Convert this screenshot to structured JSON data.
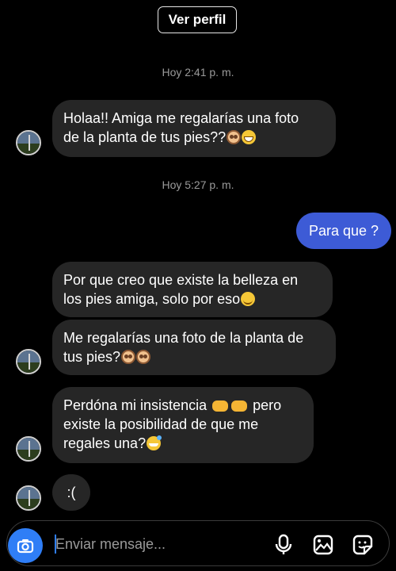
{
  "header": {
    "view_profile_label": "Ver perfil"
  },
  "timestamps": {
    "first": "Hoy 2:41 p. m.",
    "second": "Hoy 5:27 p. m."
  },
  "messages": {
    "m1_line1": "Holaa!! Amiga me regalarías una foto",
    "m1_line2": "de la planta de tus pies??",
    "m2": "Para que ?",
    "m3_line1": "Por que creo que existe la belleza en",
    "m3_line2": "los pies amiga, solo por eso",
    "m4_line1": "Me regalarías una foto de la planta de",
    "m4_line2": "tus pies?",
    "m5_line1a": "Perdóna mi insistencia",
    "m5_line1b": "pero",
    "m5_line2": "existe la posibilidad de que me",
    "m5_line3": "regales una?",
    "m6": ":("
  },
  "composer": {
    "placeholder": "Enviar mensaje..."
  },
  "colors": {
    "background": "#000000",
    "incoming_bubble": "#262626",
    "outgoing_bubble": "#3d5bd6",
    "accent": "#2f7ef6"
  },
  "icons": {
    "camera": "camera-icon",
    "mic": "microphone-icon",
    "gallery": "gallery-icon",
    "sticker": "sticker-icon"
  }
}
